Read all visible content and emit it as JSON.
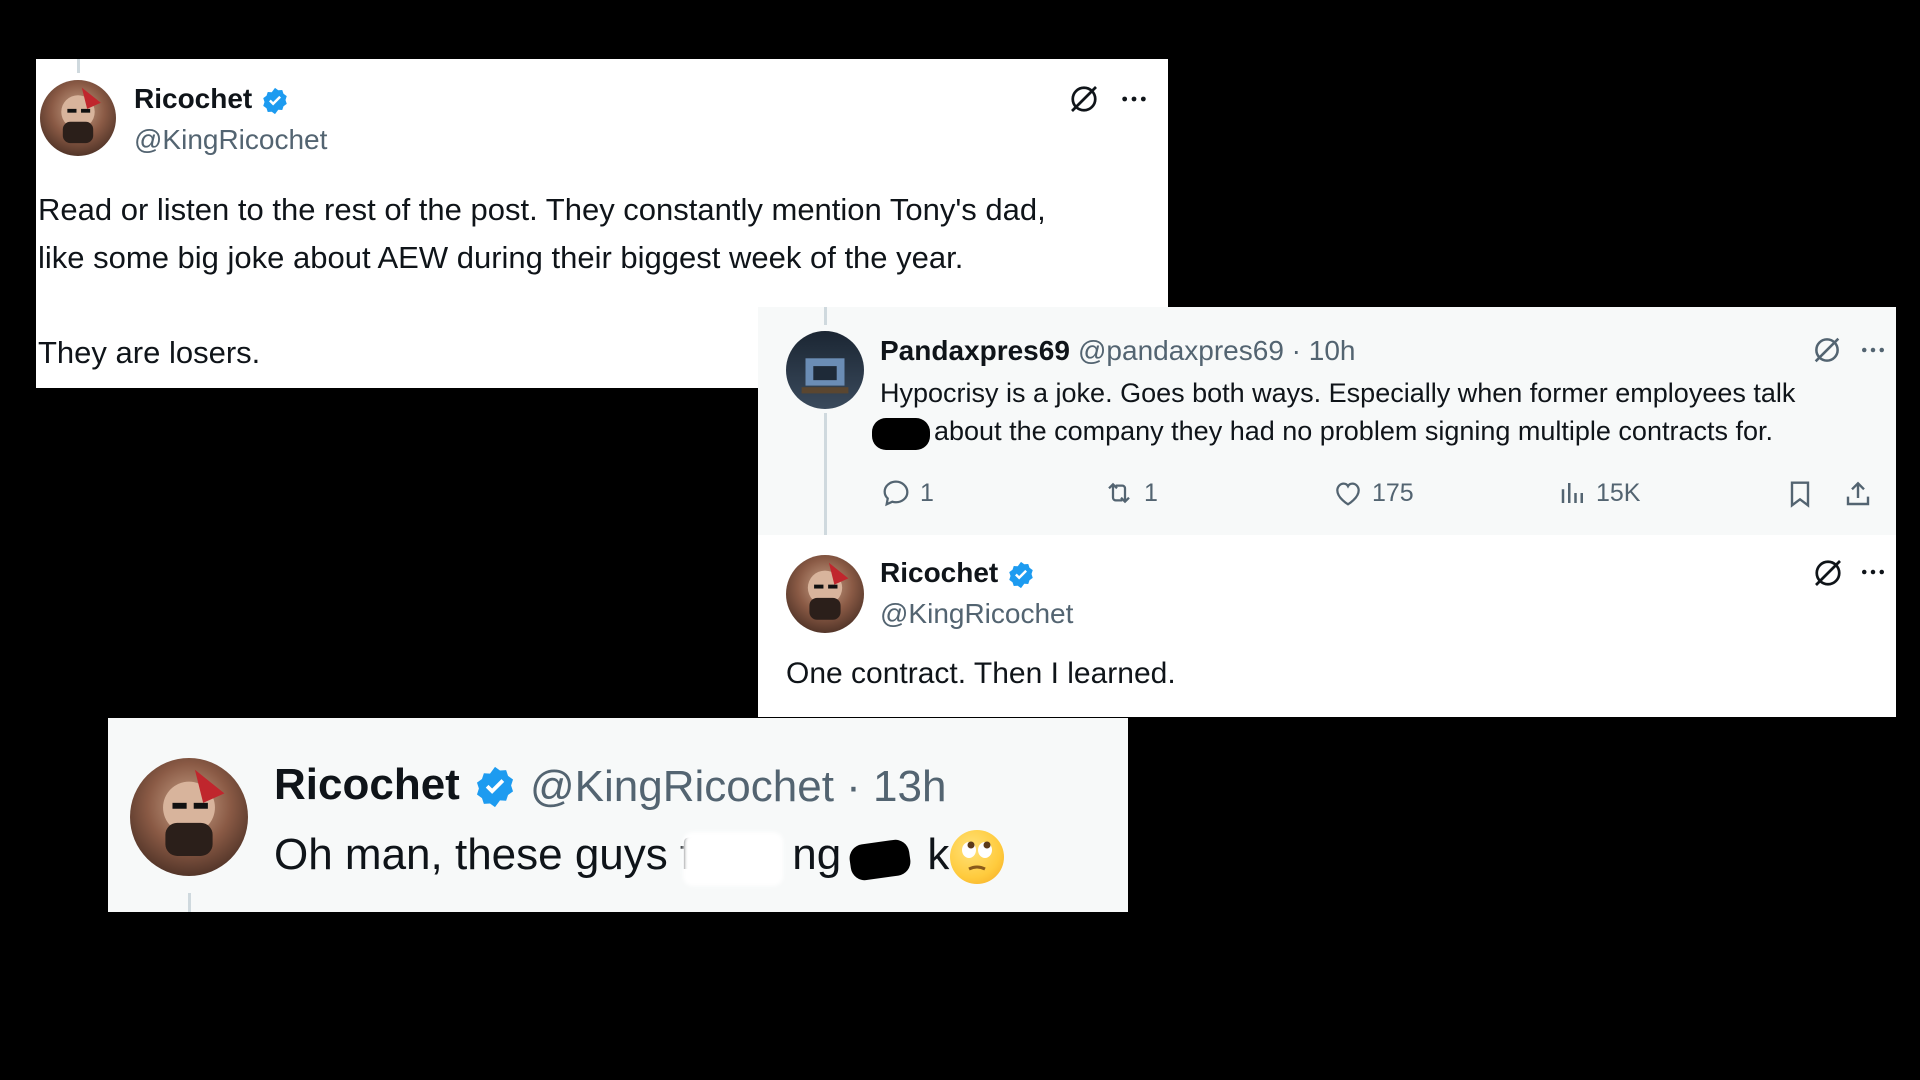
{
  "card1": {
    "name": "Ricochet",
    "handle": "@KingRicochet",
    "line1": "Read or listen to the rest of the post. They constantly mention Tony's dad,",
    "line2": "like some big joke about AEW during their biggest week of the year.",
    "line3": "They are losers."
  },
  "card2": {
    "reply": {
      "name": "Pandaxpres69",
      "meta": "@pandaxpres69 · 10h",
      "line1": "Hypocrisy is a joke. Goes both ways. Especially when former employees talk",
      "line2": "about the company they had no problem signing multiple contracts for.",
      "stats": {
        "replies": "1",
        "reposts": "1",
        "likes": "175",
        "views": "15K"
      }
    },
    "answer": {
      "name": "Ricochet",
      "handle": "@KingRicochet",
      "text": "One contract. Then I learned."
    }
  },
  "card3": {
    "name": "Ricochet",
    "meta": "@KingRicochet · 13h",
    "text_a": "Oh man, these guys f",
    "text_b": "ng s",
    "text_c": "k."
  },
  "icons": {
    "grok": "grok-icon",
    "more": "more-icon",
    "verified": "verified-badge-icon",
    "reply": "reply-icon",
    "repost": "repost-icon",
    "like": "like-icon",
    "views": "views-icon",
    "bookmark": "bookmark-icon",
    "share": "share-icon",
    "emoji": "eye-roll-emoji"
  },
  "colors": {
    "verified": "#1d9bf0",
    "muted": "#536471",
    "text": "#0f1419",
    "background": "#000000"
  }
}
